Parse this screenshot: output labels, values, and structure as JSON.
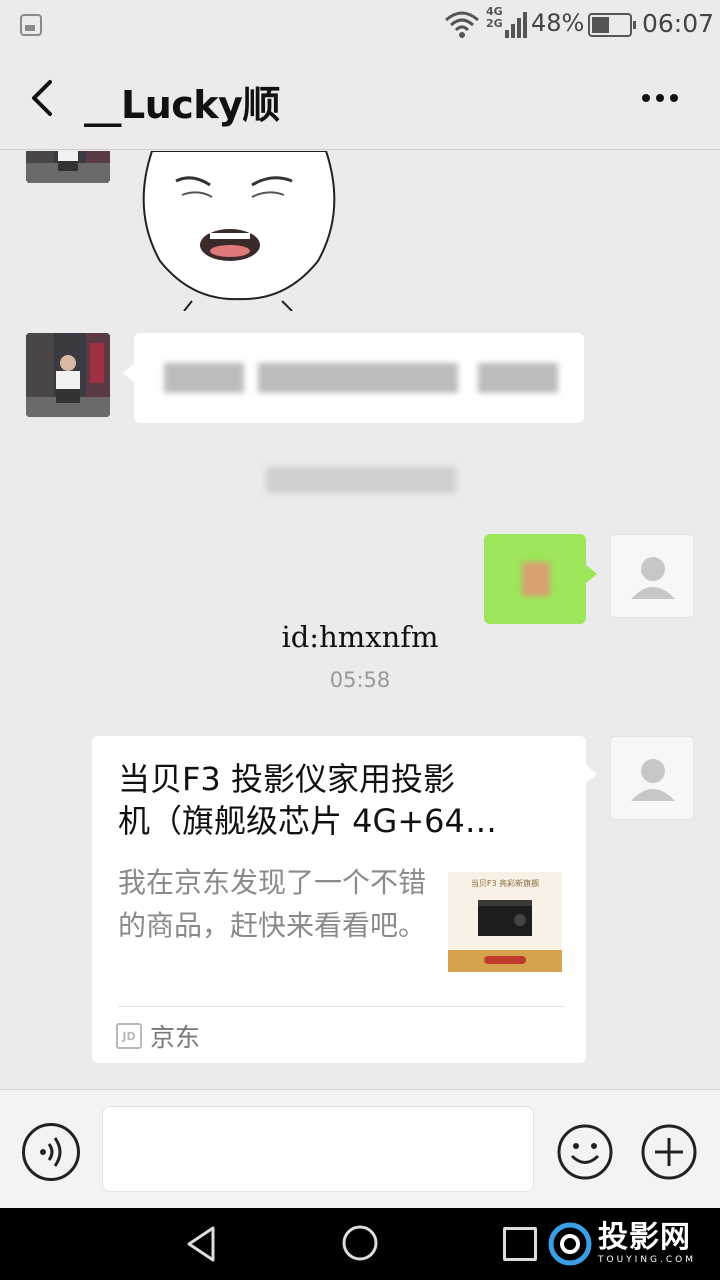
{
  "status_bar": {
    "net_4g": "4G",
    "net_2g": "2G",
    "battery": "48%",
    "time": "06:07",
    "icons": [
      "gallery-icon",
      "wifi-icon",
      "signal-icon",
      "battery-icon"
    ]
  },
  "header": {
    "title": "__Lucky顺",
    "back_icon": "back-arrow-icon",
    "more_icon": "more-dots-icon"
  },
  "chat": {
    "id_text": "id:hmxnfm",
    "time": "05:58",
    "card": {
      "title_line1": "当贝F3 投影仪家用投影",
      "title_line2": "机（旗舰级芯片 4G+64…",
      "desc": "我在京东发现了一个不错的商品，赶快来看看吧。",
      "thumb_caption": "当贝F3 亮彩新旗舰",
      "source_icon": "JD",
      "source": "京东"
    }
  },
  "input_bar": {
    "placeholder": "",
    "icons": [
      "voice-icon",
      "emoji-icon",
      "plus-icon"
    ]
  },
  "nav_bar": {
    "icons": [
      "nav-back-icon",
      "nav-home-icon",
      "nav-recent-icon"
    ],
    "watermark_cn": "投影网",
    "watermark_en": "TOUYING.COM"
  },
  "colors": {
    "background": "#ebebeb",
    "green_bubble": "#9de65a",
    "white_bubble": "#ffffff",
    "nav_bar": "#000000"
  }
}
